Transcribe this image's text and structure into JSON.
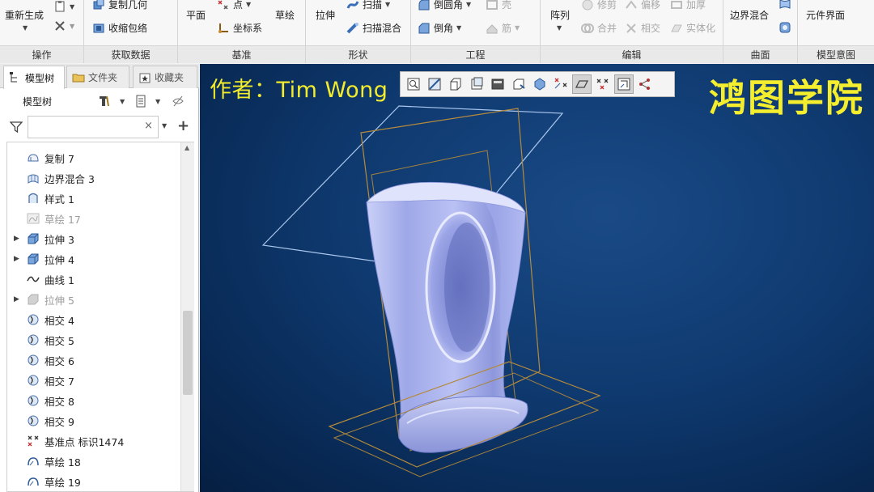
{
  "ribbon": {
    "groups": {
      "operations": "操作",
      "get_data": "获取数据",
      "datum": "基准",
      "shapes": "形状",
      "engineering": "工程",
      "editing": "编辑",
      "surfaces": "曲面",
      "model_intent": "模型意图"
    },
    "regenerate": "重新生成",
    "copy_geometry": "复制几何",
    "shrinkwrap": "收缩包络",
    "plane": "平面",
    "point": "点",
    "csys": "坐标系",
    "sketch": "草绘",
    "extrude": "拉伸",
    "sweep": "扫描",
    "swept_blend": "扫描混合",
    "round": "倒圆角",
    "chamfer": "倒角",
    "shell": "壳",
    "rib": "筋",
    "pattern": "阵列",
    "trim": "修剪",
    "offset": "偏移",
    "thicken": "加厚",
    "merge": "合并",
    "intersect": "相交",
    "solidify": "实体化",
    "boundary_blend": "边界混合",
    "component_interface": "元件界面"
  },
  "panel": {
    "tabs": [
      "模型树",
      "文件夹",
      "收藏夹"
    ],
    "title": "模型树",
    "search_value": ""
  },
  "tree": {
    "items": [
      {
        "label": "复制 7",
        "icon": "copy-icon",
        "expandable": false,
        "dim": false
      },
      {
        "label": "边界混合 3",
        "icon": "boundary-blend-icon",
        "expandable": false,
        "dim": false
      },
      {
        "label": "样式 1",
        "icon": "style-icon",
        "expandable": false,
        "dim": false
      },
      {
        "label": "草绘 17",
        "icon": "sketch-icon",
        "expandable": false,
        "dim": true
      },
      {
        "label": "拉伸 3",
        "icon": "extrude-icon",
        "expandable": true,
        "dim": false
      },
      {
        "label": "拉伸 4",
        "icon": "extrude-icon",
        "expandable": true,
        "dim": false
      },
      {
        "label": "曲线 1",
        "icon": "curve-icon",
        "expandable": false,
        "dim": false
      },
      {
        "label": "拉伸 5",
        "icon": "extrude-icon",
        "expandable": true,
        "dim": true
      },
      {
        "label": "相交 4",
        "icon": "intersect-icon",
        "expandable": false,
        "dim": false
      },
      {
        "label": "相交 5",
        "icon": "intersect-icon",
        "expandable": false,
        "dim": false
      },
      {
        "label": "相交 6",
        "icon": "intersect-icon",
        "expandable": false,
        "dim": false
      },
      {
        "label": "相交 7",
        "icon": "intersect-icon",
        "expandable": false,
        "dim": false
      },
      {
        "label": "相交 8",
        "icon": "intersect-icon",
        "expandable": false,
        "dim": false
      },
      {
        "label": "相交 9",
        "icon": "intersect-icon",
        "expandable": false,
        "dim": false
      },
      {
        "label": "基准点 标识1474",
        "icon": "datum-point-icon",
        "expandable": false,
        "dim": false
      },
      {
        "label": "草绘 18",
        "icon": "sketch-icon",
        "expandable": false,
        "dim": false
      },
      {
        "label": "草绘 19",
        "icon": "sketch-icon",
        "expandable": false,
        "dim": false
      }
    ]
  },
  "graphics": {
    "author": "作者：Tim Wong",
    "brand": "鸿图学院"
  },
  "colors": {
    "background": "#0f3a70",
    "watermark": "#f4ee2e",
    "model": "#aab4f2",
    "datum_plane": "#b58a3c"
  }
}
